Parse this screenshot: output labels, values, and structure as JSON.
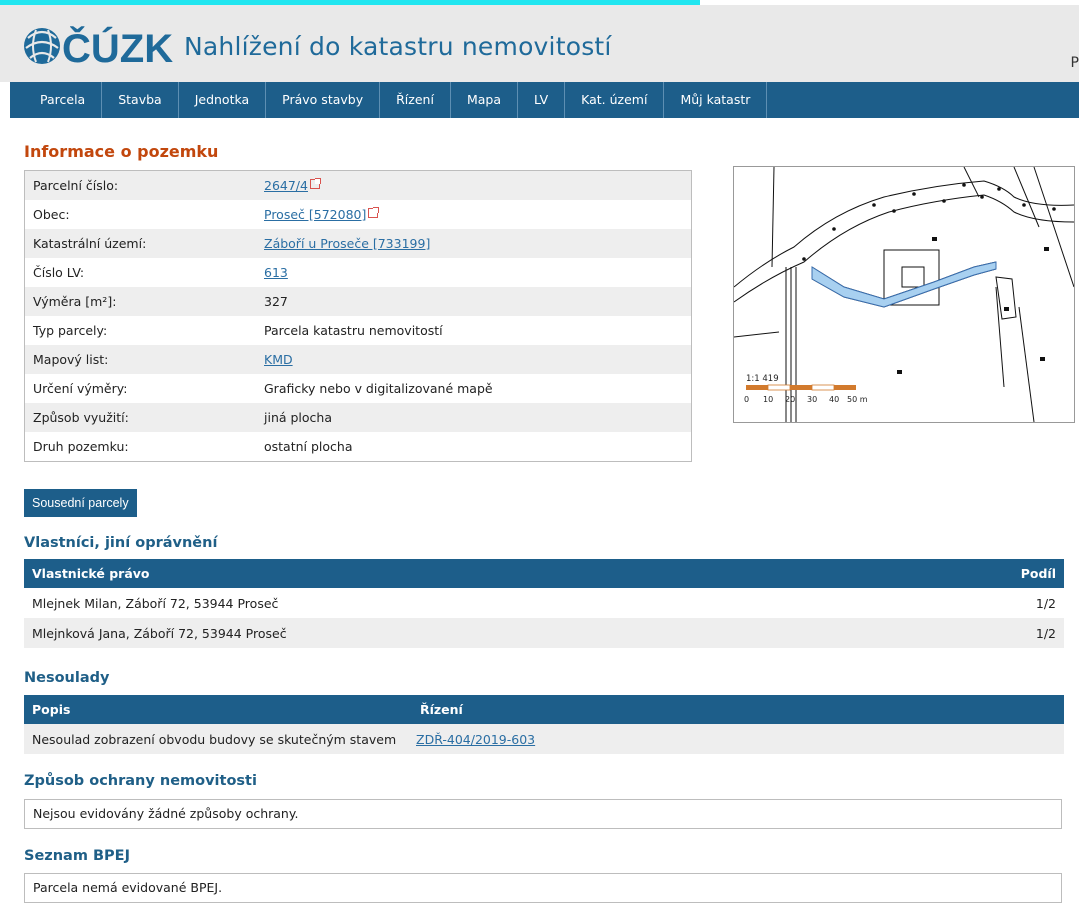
{
  "header": {
    "title": "Nahlížení do katastru nemovitostí",
    "logo_text": "ČÚZK",
    "edge_text": "P"
  },
  "nav": [
    "Parcela",
    "Stavba",
    "Jednotka",
    "Právo stavby",
    "Řízení",
    "Mapa",
    "LV",
    "Kat. území",
    "Můj katastr"
  ],
  "info": {
    "title": "Informace o pozemku",
    "rows": [
      {
        "key": "Parcelní číslo:",
        "value": "2647/4",
        "link": true,
        "ext": true
      },
      {
        "key": "Obec:",
        "value": "Proseč [572080]",
        "link": true,
        "ext": true
      },
      {
        "key": "Katastrální území:",
        "value": "Záboří u Proseče [733199]",
        "link": true,
        "ext": false
      },
      {
        "key": "Číslo LV:",
        "value": "613",
        "link": true,
        "ext": false
      },
      {
        "key": "Výměra [m²]:",
        "value": "327",
        "link": false,
        "ext": false
      },
      {
        "key": "Typ parcely:",
        "value": "Parcela katastru nemovitostí",
        "link": false,
        "ext": false
      },
      {
        "key": "Mapový list:",
        "value": "KMD",
        "link": true,
        "ext": false
      },
      {
        "key": "Určení výměry:",
        "value": "Graficky nebo v digitalizované mapě",
        "link": false,
        "ext": false
      },
      {
        "key": "Způsob využití:",
        "value": "jiná plocha",
        "link": false,
        "ext": false
      },
      {
        "key": "Druh pozemku:",
        "value": "ostatní plocha",
        "link": false,
        "ext": false
      }
    ]
  },
  "map": {
    "scale_label": "1:1 419",
    "scale_ticks": [
      "0",
      "10",
      "20",
      "30",
      "40",
      "50 m"
    ]
  },
  "neighbors_button": "Sousední parcely",
  "owners": {
    "title": "Vlastníci, jiní oprávnění",
    "col_right": "Vlastnické právo",
    "col_share": "Podíl",
    "rows": [
      {
        "name": "Mlejnek Milan, Záboří 72, 53944 Proseč",
        "share": "1/2"
      },
      {
        "name": "Mlejnková Jana, Záboří 72, 53944 Proseč",
        "share": "1/2"
      }
    ]
  },
  "discrepancies": {
    "title": "Nesoulady",
    "col_desc": "Popis",
    "col_proc": "Řízení",
    "rows": [
      {
        "desc": "Nesoulad zobrazení obvodu budovy se skutečným stavem",
        "proc": "ZDŘ-404/2019-603"
      }
    ]
  },
  "protection": {
    "title": "Způsob ochrany nemovitosti",
    "text": "Nejsou evidovány žádné způsoby ochrany."
  },
  "bpej": {
    "title": "Seznam BPEJ",
    "text": "Parcela nemá evidované BPEJ."
  }
}
